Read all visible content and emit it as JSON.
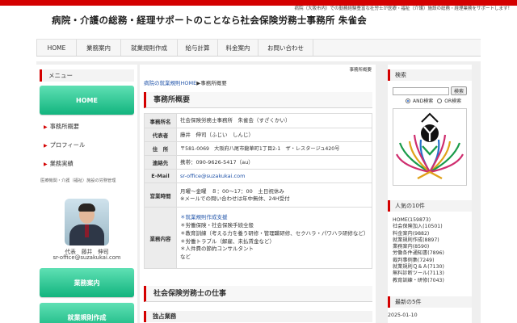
{
  "header": {
    "tagline": "病院（大阪市内）での勤務経験豊富な社労士が医療・福祉（介護）施設の総務・経理業務をサポートします！",
    "site_title": "病院・介護の総務・経理サポートのことなら社会保険労務士事務所 朱雀会",
    "accent_color": "#d40000"
  },
  "global_nav": [
    "HOME",
    "業務案内",
    "就業規則作成",
    "給与計算",
    "料金案内",
    "お問い合わせ"
  ],
  "left_sidebar": {
    "menu_heading": "メニュー",
    "home_button": "HOME",
    "links": [
      "事務所概要",
      "プロフィール",
      "業務実績"
    ],
    "note": "医療機関・介護（福祉）施設の労務管理",
    "photo_caption_1": "代表　藤井　伸司",
    "photo_caption_2": "sr-office@suzakukai.com",
    "service_button": "業務案内",
    "rules_button": "就業規則作成",
    "button_color": "#12b47e"
  },
  "main": {
    "corner_label": "事務所概要",
    "breadcrumb_home": "病院の就業規則HOME",
    "breadcrumb_sep": "▶",
    "breadcrumb_current": "事務所概要",
    "section_title": "事務所概要",
    "table": [
      {
        "label": "事務所名",
        "value": "社会保険労務士事務所　朱雀会（すざくかい）"
      },
      {
        "label": "代表者",
        "value": "藤井　伸司（ふじい　しんじ）"
      },
      {
        "label": "住　所",
        "value": "〒581-0069　大阪府八尾市龍華町1丁目2-1　ザ・レスタージュ420号"
      },
      {
        "label": "連絡先",
        "value": "携帯：090-9626-5417（au）"
      },
      {
        "label": "E-Mail",
        "value": "sr-office@suzakukai.com"
      },
      {
        "label": "営業時間",
        "line1": "月曜〜金曜　８：00〜17：00　土日祝休み",
        "line2": "※メールでの問い合わせは年中無休、24H受付"
      },
      {
        "label": "業務内容",
        "items": [
          "＊就業規則作成支援",
          "＊労働保険・社会保険手続全般",
          "＊教育訓練（考える力を養う研修・管理職研修、セクハラ・パワハラ研修など）",
          "＊労働トラブル（解雇、未払賃金など）",
          "＊人件費の節約コンサルタント",
          "など"
        ]
      }
    ],
    "section2_title": "社会保険労務士の仕事",
    "sub_heading": "独占業務"
  },
  "right_sidebar": {
    "search_heading": "検索",
    "search_value": "",
    "search_button": "検索",
    "radio_and": "AND検索",
    "radio_or": "OR検索",
    "radio_selected": "AND検索",
    "popular_heading": "人気の10件",
    "popular_list": [
      "HOME(159873)",
      "社会保険加入(10501)",
      "料金案内(9882)",
      "就業規則作成(8897)",
      "業務案内(8590)",
      "労働条件通知書(7896)",
      "裁判事例集(7249)",
      "就業規則Ｑ＆Ａ(7130)",
      "無料診断ツール(7113)",
      "教育訓練・研修(7043)"
    ],
    "recent_heading": "最新の5件",
    "recent_date": "2025-01-10"
  }
}
